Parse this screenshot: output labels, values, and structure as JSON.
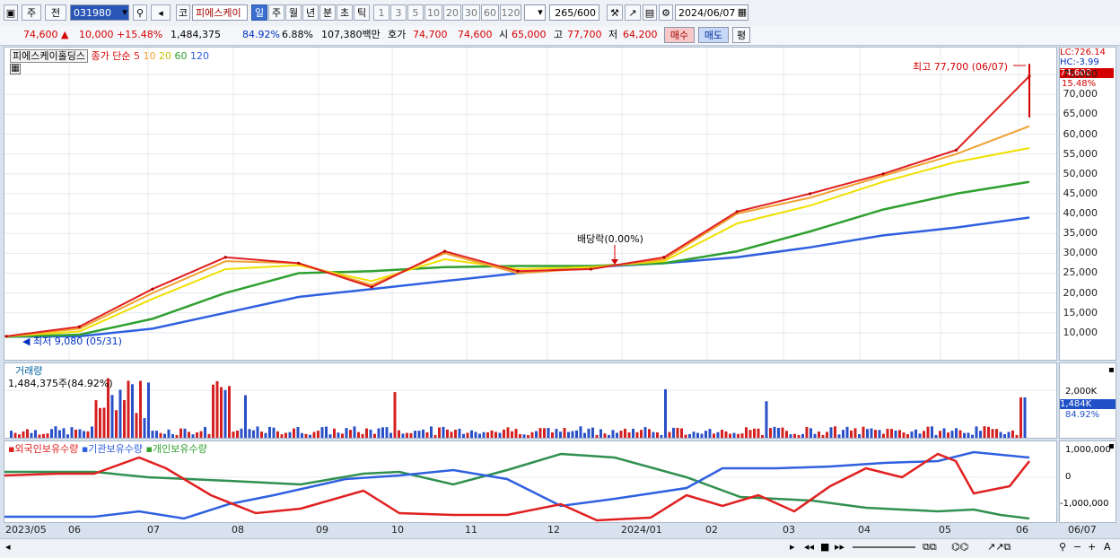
{
  "toolbar": {
    "market": "주",
    "prev_label": "전",
    "code": "031980",
    "market_badge": "코",
    "stock_name": "피에스케이",
    "periods": [
      "일",
      "주",
      "월",
      "년",
      "분",
      "초",
      "틱"
    ],
    "active_period": "일",
    "intervals": [
      "1",
      "3",
      "5",
      "10",
      "20",
      "30",
      "60",
      "120"
    ],
    "count": "265",
    "count_total": "/600",
    "date": "2024/06/07"
  },
  "quote": {
    "price": "74,600",
    "change": "10,000",
    "change_pct": "+15.48%",
    "volume": "1,484,375",
    "vol_ratio": "84.92%",
    "turnover": "6.88%",
    "amount": "107,380백만",
    "hoga_label": "호가",
    "ask": "74,700",
    "bid": "74,600",
    "open_label": "시",
    "open": "65,000",
    "high_label": "고",
    "high": "77,700",
    "low_label": "저",
    "low": "64,200",
    "buy_label": "매수",
    "sell_label": "매도",
    "eval_label": "평"
  },
  "legend": {
    "name": "피에스케이홀딩스",
    "series": "종가 단순",
    "ma": [
      {
        "label": "5",
        "color": "#e02020"
      },
      {
        "label": "10",
        "color": "#f0a030"
      },
      {
        "label": "20",
        "color": "#e8e000"
      },
      {
        "label": "60",
        "color": "#30a030"
      },
      {
        "label": "120",
        "color": "#3060e0"
      }
    ]
  },
  "annotations": {
    "high": "최고 77,700 (06/07)",
    "dividend": "배당락(0.00%)",
    "low": "최저 9,080 (05/31)",
    "lc": "LC:726.14",
    "hc": "HC:-3.99",
    "last_price": "74,600",
    "last_pct": "15.48%"
  },
  "volume_panel": {
    "title": "거래량",
    "value": "1,484,375주(84.92%)",
    "last": "1,484K",
    "last_pct": "84.92%",
    "tick": "2,000K"
  },
  "holdings_panel": {
    "labels": [
      "외국인보유수량",
      "기관보유수량",
      "개인보유수량"
    ],
    "colors": [
      "#e02020",
      "#3060e0",
      "#30a030"
    ],
    "ticks": [
      "1,000,000",
      "0",
      "-1,000,000"
    ]
  },
  "x_labels": [
    "2023/05",
    "06",
    "07",
    "08",
    "09",
    "10",
    "11",
    "12",
    "2024/01",
    "02",
    "03",
    "04",
    "05",
    "06",
    "06/07"
  ],
  "chart_data": {
    "type": "line",
    "title": "피에스케이홀딩스",
    "y_ticks": [
      "75,000",
      "70,000",
      "65,000",
      "60,000",
      "55,000",
      "50,000",
      "45,000",
      "40,000",
      "35,000",
      "30,000",
      "25,000",
      "20,000",
      "15,000",
      "10,000"
    ],
    "ylim": [
      5000,
      80000
    ],
    "x": [
      "2023/05",
      "06",
      "07",
      "08",
      "09",
      "10",
      "11",
      "12",
      "2024/01",
      "02",
      "03",
      "04",
      "05",
      "06",
      "06/07"
    ],
    "series": [
      {
        "name": "5",
        "values": [
          9100,
          11500,
          21000,
          29000,
          27500,
          21500,
          30500,
          25500,
          26000,
          29000,
          40500,
          45000,
          50000,
          56000,
          74600
        ]
      },
      {
        "name": "10",
        "values": [
          9100,
          11000,
          20000,
          28000,
          27500,
          22000,
          30000,
          25000,
          26200,
          28500,
          40000,
          44000,
          49500,
          55000,
          62000
        ]
      },
      {
        "name": "20",
        "values": [
          9100,
          10300,
          18500,
          26000,
          27000,
          23000,
          28500,
          26000,
          26500,
          28000,
          37500,
          42000,
          48000,
          53000,
          56500
        ]
      },
      {
        "name": "60",
        "values": [
          9000,
          9500,
          13500,
          20000,
          25000,
          25500,
          26500,
          26800,
          26800,
          27500,
          30500,
          35500,
          41000,
          45000,
          48000
        ]
      },
      {
        "name": "120",
        "values": [
          9000,
          9100,
          11000,
          15000,
          19000,
          21000,
          23000,
          25000,
          26500,
          27500,
          29000,
          31500,
          34500,
          36500,
          39000
        ]
      }
    ]
  }
}
